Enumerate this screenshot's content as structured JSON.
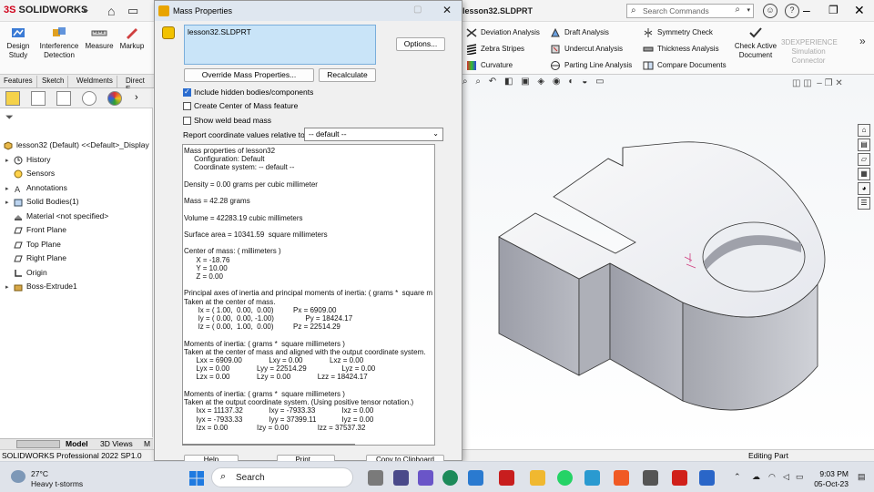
{
  "app": {
    "logo_prefix": "3S",
    "logo_text": "SOLIDWORKS",
    "document_title": "lesson32.SLDPRT",
    "search_placeholder": "Search Commands"
  },
  "command_manager": {
    "buttons": [
      {
        "label": "Design\nStudy"
      },
      {
        "label": "Interference\nDetection"
      },
      {
        "label": "Measure"
      },
      {
        "label": "Markup"
      }
    ],
    "right_tools": [
      {
        "label": "Deviation Analysis"
      },
      {
        "label": "Draft Analysis"
      },
      {
        "label": "Symmetry Check"
      },
      {
        "label": "Zebra Stripes"
      },
      {
        "label": "Undercut Analysis"
      },
      {
        "label": "Thickness Analysis"
      },
      {
        "label": "Curvature"
      },
      {
        "label": "Parting Line Analysis"
      },
      {
        "label": "Compare Documents"
      }
    ],
    "check_active": "Check Active\nDocument",
    "experience": "3DEXPERIENCE\nSimulation\nConnector"
  },
  "tabs": [
    "Features",
    "Sketch",
    "Weldments",
    "Direct E"
  ],
  "feature_tree": {
    "root": "lesson32 (Default) <<Default>_Display",
    "items": [
      {
        "label": "History",
        "expand": true
      },
      {
        "label": "Sensors",
        "expand": false
      },
      {
        "label": "Annotations",
        "expand": true
      },
      {
        "label": "Solid Bodies(1)",
        "expand": true
      },
      {
        "label": "Material <not specified>",
        "expand": false
      },
      {
        "label": "Front Plane",
        "expand": false
      },
      {
        "label": "Top Plane",
        "expand": false
      },
      {
        "label": "Right Plane",
        "expand": false
      },
      {
        "label": "Origin",
        "expand": false
      },
      {
        "label": "Boss-Extrude1",
        "expand": true
      }
    ]
  },
  "bottom_tabs": [
    "Model",
    "3D Views",
    "M"
  ],
  "status": {
    "left": "SOLIDWORKS Professional 2022 SP1.0",
    "right": "Editing Part"
  },
  "dialog": {
    "title": "Mass Properties",
    "selection": "lesson32.SLDPRT",
    "options_btn": "Options...",
    "override_btn": "Override Mass Properties...",
    "recalc_btn": "Recalculate",
    "checks": [
      {
        "label": "Include hidden bodies/components",
        "checked": true
      },
      {
        "label": "Create Center of Mass feature",
        "checked": false
      },
      {
        "label": "Show weld bead mass",
        "checked": false
      }
    ],
    "coord_label": "Report coordinate values relative to:",
    "coord_value": "-- default --",
    "results": "Mass properties of lesson32\n     Configuration: Default\n     Coordinate system: -- default --\n\nDensity = 0.00 grams per cubic millimeter\n\nMass = 42.28 grams\n\nVolume = 42283.19 cubic millimeters\n\nSurface area = 10341.59  square millimeters\n\nCenter of mass: ( millimeters )\n\tX = -18.76\n\tY = 10.00\n\tZ = 0.00\n\nPrincipal axes of inertia and principal moments of inertia: ( grams *  square m\nTaken at the center of mass.\n\t Ix = ( 1.00,  0.00,  0.00)   \t\tPx = 6909.00\n\t Iy = ( 0.00,  0.00, -1.00)   \t\tPy = 18424.17\n\t Iz = ( 0.00,  1.00,  0.00)   \t\tPz = 22514.29\n\nMoments of inertia: ( grams *  square millimeters )\nTaken at the center of mass and aligned with the output coordinate system.\n\tLxx = 6909.00\t\t\tLxy = 0.00\t\t\tLxz = 0.00\n\tLyx = 0.00\t\t\tLyy = 22514.29\t\t\tLyz = 0.00\n\tLzx = 0.00\t\t\tLzy = 0.00\t\t\tLzz = 18424.17\n\nMoments of inertia: ( grams *  square millimeters )\nTaken at the output coordinate system. (Using positive tensor notation.)\n\tIxx = 11137.32\t\t\tIxy = -7933.33\t\t\tIxz = 0.00\n\tIyx = -7933.33\t\t\tIyy = 37399.11\t\t\tIyz = 0.00\n\tIzx = 0.00\t\t\tIzy = 0.00\t\t\tIzz = 37537.32",
    "footer_buttons": [
      "Help",
      "Print...",
      "Copy to Clipboard"
    ]
  },
  "taskbar": {
    "weather_temp": "27°C",
    "weather_desc": "Heavy t-storms",
    "search": "Search",
    "time": "9:03 PM",
    "date": "05-Oct-23"
  },
  "colors": {
    "accent": "#2a6ccf",
    "selection_bg": "#c9e4f8",
    "logo_red": "#d0021b"
  }
}
